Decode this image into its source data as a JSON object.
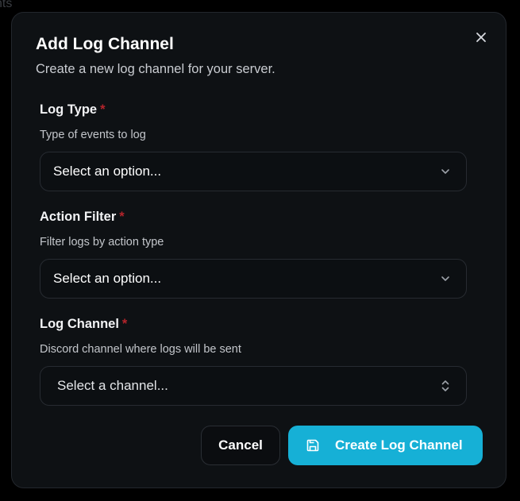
{
  "backdrop": {
    "fragment_text": "nts"
  },
  "dialog": {
    "title": "Add Log Channel",
    "subtitle": "Create a new log channel for your server.",
    "close_icon": "close-icon"
  },
  "fields": {
    "log_type": {
      "label": "Log Type",
      "required_mark": "*",
      "description": "Type of events to log",
      "value": "Select an option...",
      "icon": "chevron-down-icon"
    },
    "action_filter": {
      "label": "Action Filter",
      "required_mark": "*",
      "description": "Filter logs by action type",
      "value": "Select an option...",
      "icon": "chevron-down-icon"
    },
    "log_channel": {
      "label": "Log Channel",
      "required_mark": "*",
      "description": "Discord channel where logs will be sent",
      "value": "Select a channel...",
      "icon": "chevrons-up-down-icon"
    }
  },
  "actions": {
    "cancel_label": "Cancel",
    "submit_label": "Create Log Channel",
    "submit_icon": "save-icon"
  },
  "colors": {
    "background": "#000000",
    "dialog_bg": "#0e1114",
    "accent": "#16b0d6",
    "required": "#b4242b"
  }
}
